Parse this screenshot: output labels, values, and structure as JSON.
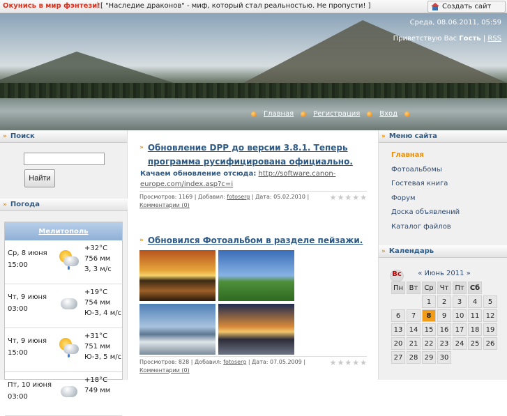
{
  "topbar": {
    "promo": "Окунись в мир фэнтези!",
    "message": "[ \"Наследие драконов\" - миф, который стал реальностью. Не пропусти! ]",
    "create_site": "Создать сайт"
  },
  "header": {
    "datetime": "Среда, 08.06.2011, 05:59",
    "greeting_prefix": "Приветствую Вас",
    "user": "Гость",
    "divider": "|",
    "rss": "RSS",
    "nav": [
      "Главная",
      "Регистрация",
      "Вход"
    ]
  },
  "left": {
    "search_title": "Поиск",
    "search_button": "Найти",
    "search_value": "",
    "weather_title": "Погода",
    "city": "Мелитополь",
    "forecast": [
      {
        "day": "Ср, 8 июня",
        "time": "15:00",
        "temp": "+32°C",
        "pressure": "756 мм",
        "wind": "З, 3 м/с",
        "icon": "sun-cloud-rain-icon"
      },
      {
        "day": "Чт, 9 июня",
        "time": "03:00",
        "temp": "+19°C",
        "pressure": "754 мм",
        "wind": "Ю-З, 4 м/с",
        "icon": "cloud-icon"
      },
      {
        "day": "Чт, 9 июня",
        "time": "15:00",
        "temp": "+31°C",
        "pressure": "751 мм",
        "wind": "Ю-З, 5 м/с",
        "icon": "sun-cloud-rain-icon"
      },
      {
        "day": "Пт, 10 июня",
        "time": "03:00",
        "temp": "+18°C",
        "pressure": "749 мм",
        "wind": "",
        "icon": "cloud-icon"
      }
    ]
  },
  "posts": [
    {
      "title_line1": "Обновление DPP до версии 3.8.1. Теперь",
      "title_line2": "программа русифицирована официально.",
      "body_label": "Качаем обновление отсюда:",
      "body_link1": "http://software.canon-",
      "body_link2": "europe.com/index.asp?c=i",
      "meta": "Просмотров: 1169 | Добавил:",
      "author": "fotoserg",
      "date": "| Дата: 05.02.2010 |",
      "comments": "Комментарии (0)"
    },
    {
      "title_line1": "Обновился Фотоальбом в разделе пейзажи.",
      "meta": "Просмотров: 828 | Добавил:",
      "author": "fotoserg",
      "date": "| Дата: 07.05.2009 |",
      "comments": "Комментарии (0)"
    }
  ],
  "right": {
    "menu_title": "Меню сайта",
    "menu": [
      "Главная",
      "Фотоальбомы",
      "Гостевая книга",
      "Форум",
      "Доска объявлений",
      "Каталог файлов"
    ],
    "calendar_title": "Календарь",
    "calendar_month": "Июнь 2011",
    "prev": "«",
    "next": "»",
    "weekdays": [
      "Пн",
      "Вт",
      "Ср",
      "Чт",
      "Пт",
      "Сб",
      "Вс"
    ],
    "today": "8"
  }
}
